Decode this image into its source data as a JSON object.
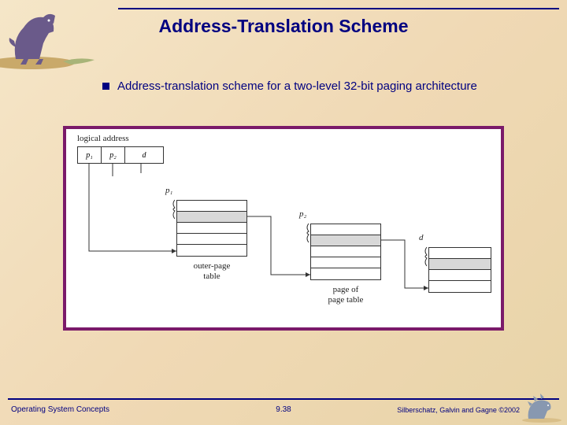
{
  "title": "Address-Translation Scheme",
  "bullet": "Address-translation scheme for a two-level 32-bit paging architecture",
  "figure": {
    "logical_address_label": "logical address",
    "fields": {
      "p1": "p₁",
      "p2": "p₂",
      "d": "d"
    },
    "pointer_labels": {
      "p1": "p₁",
      "p2": "p₂",
      "d": "d"
    },
    "outer_label_l1": "outer-page",
    "outer_label_l2": "table",
    "inner_label_l1": "page of",
    "inner_label_l2": "page table"
  },
  "footer": {
    "left": "Operating System Concepts",
    "mid": "9.38",
    "right": "Silberschatz, Galvin and Gagne ©2002"
  }
}
